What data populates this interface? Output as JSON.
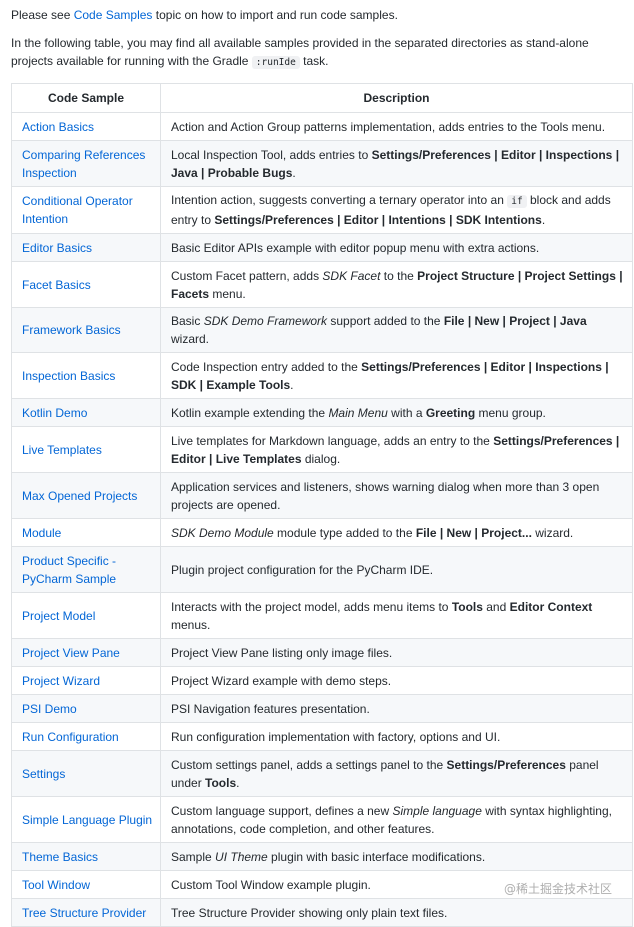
{
  "intro": {
    "line1_prefix": "Please see ",
    "line1_link": "Code Samples",
    "line1_suffix": " topic on how to import and run code samples.",
    "line2_prefix": "In the following table, you may find all available samples provided in the separated directories as stand-alone projects available for running with the Gradle ",
    "line2_code": ":runIde",
    "line2_suffix": " task."
  },
  "table": {
    "headers": [
      "Code Sample",
      "Description"
    ],
    "rows": [
      {
        "name": "Action Basics",
        "desc": [
          {
            "t": "Action and Action Group patterns implementation, adds entries to the Tools menu."
          }
        ]
      },
      {
        "name": "Comparing References Inspection",
        "desc": [
          {
            "t": "Local Inspection Tool, adds entries to "
          },
          {
            "t": "Settings/Preferences | Editor | Inspections | Java | Probable Bugs",
            "s": "b"
          },
          {
            "t": "."
          }
        ]
      },
      {
        "name": "Conditional Operator Intention",
        "desc": [
          {
            "t": "Intention action, suggests converting a ternary operator into an "
          },
          {
            "t": "if",
            "s": "code"
          },
          {
            "t": " block and adds entry to "
          },
          {
            "t": "Settings/Preferences | Editor | Intentions | SDK Intentions",
            "s": "b"
          },
          {
            "t": "."
          }
        ]
      },
      {
        "name": "Editor Basics",
        "desc": [
          {
            "t": "Basic Editor APIs example with editor popup menu with extra actions."
          }
        ]
      },
      {
        "name": "Facet Basics",
        "desc": [
          {
            "t": "Custom Facet pattern, adds "
          },
          {
            "t": "SDK Facet",
            "s": "i"
          },
          {
            "t": " to the "
          },
          {
            "t": "Project Structure | Project Settings | Facets",
            "s": "b"
          },
          {
            "t": " menu."
          }
        ]
      },
      {
        "name": "Framework Basics",
        "desc": [
          {
            "t": "Basic "
          },
          {
            "t": "SDK Demo Framework",
            "s": "i"
          },
          {
            "t": " support added to the "
          },
          {
            "t": "File | New | Project | Java",
            "s": "b"
          },
          {
            "t": " wizard."
          }
        ]
      },
      {
        "name": "Inspection Basics",
        "desc": [
          {
            "t": "Code Inspection entry added to the "
          },
          {
            "t": "Settings/Preferences | Editor | Inspections | SDK | Example Tools",
            "s": "b"
          },
          {
            "t": "."
          }
        ]
      },
      {
        "name": "Kotlin Demo",
        "desc": [
          {
            "t": "Kotlin example extending the "
          },
          {
            "t": "Main Menu",
            "s": "i"
          },
          {
            "t": " with a "
          },
          {
            "t": "Greeting",
            "s": "b"
          },
          {
            "t": " menu group."
          }
        ]
      },
      {
        "name": "Live Templates",
        "desc": [
          {
            "t": "Live templates for Markdown language, adds an entry to the "
          },
          {
            "t": "Settings/Preferences | Editor | Live Templates",
            "s": "b"
          },
          {
            "t": " dialog."
          }
        ]
      },
      {
        "name": "Max Opened Projects",
        "desc": [
          {
            "t": "Application services and listeners, shows warning dialog when more than 3 open projects are opened."
          }
        ]
      },
      {
        "name": "Module",
        "desc": [
          {
            "t": "SDK Demo Module",
            "s": "i"
          },
          {
            "t": " module type added to the "
          },
          {
            "t": "File | New | Project...",
            "s": "b"
          },
          {
            "t": " wizard."
          }
        ]
      },
      {
        "name": "Product Specific - PyCharm Sample",
        "desc": [
          {
            "t": "Plugin project configuration for the PyCharm IDE."
          }
        ]
      },
      {
        "name": "Project Model",
        "desc": [
          {
            "t": "Interacts with the project model, adds menu items to "
          },
          {
            "t": "Tools",
            "s": "b"
          },
          {
            "t": " and "
          },
          {
            "t": "Editor Context",
            "s": "b"
          },
          {
            "t": " menus."
          }
        ]
      },
      {
        "name": "Project View Pane",
        "desc": [
          {
            "t": "Project View Pane listing only image files."
          }
        ]
      },
      {
        "name": "Project Wizard",
        "desc": [
          {
            "t": "Project Wizard example with demo steps."
          }
        ]
      },
      {
        "name": "PSI Demo",
        "desc": [
          {
            "t": "PSI Navigation features presentation."
          }
        ]
      },
      {
        "name": "Run Configuration",
        "desc": [
          {
            "t": "Run configuration implementation with factory, options and UI."
          }
        ]
      },
      {
        "name": "Settings",
        "desc": [
          {
            "t": "Custom settings panel, adds a settings panel to the "
          },
          {
            "t": "Settings/Preferences",
            "s": "b"
          },
          {
            "t": " panel under "
          },
          {
            "t": "Tools",
            "s": "b"
          },
          {
            "t": "."
          }
        ]
      },
      {
        "name": "Simple Language Plugin",
        "desc": [
          {
            "t": "Custom language support, defines a new "
          },
          {
            "t": "Simple language",
            "s": "i"
          },
          {
            "t": " with syntax highlighting, annotations, code completion, and other features."
          }
        ]
      },
      {
        "name": "Theme Basics",
        "desc": [
          {
            "t": "Sample "
          },
          {
            "t": "UI Theme",
            "s": "i"
          },
          {
            "t": " plugin with basic interface modifications."
          }
        ]
      },
      {
        "name": "Tool Window",
        "desc": [
          {
            "t": "Custom Tool Window example plugin."
          }
        ]
      },
      {
        "name": "Tree Structure Provider",
        "desc": [
          {
            "t": "Tree Structure Provider showing only plain text files."
          }
        ]
      }
    ]
  },
  "watermark": "@稀土掘金技术社区",
  "colors": {
    "link": "#0366d6",
    "border": "#dfe2e5",
    "stripe": "#f6f8fa"
  }
}
